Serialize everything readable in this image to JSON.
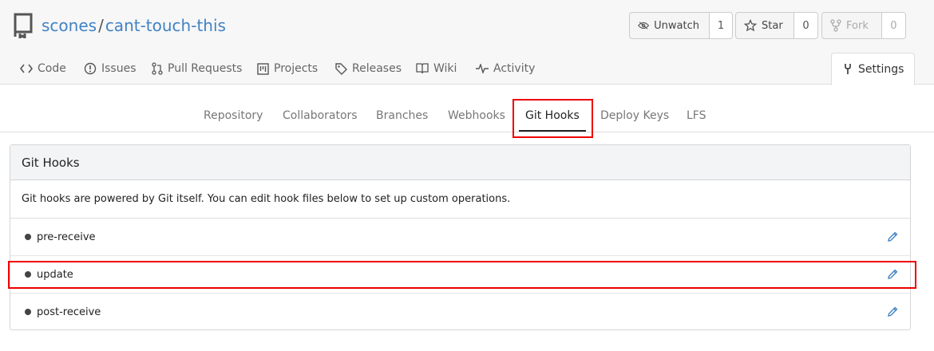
{
  "repo": {
    "owner": "scones",
    "separator": "/",
    "name": "cant-touch-this"
  },
  "actions": {
    "watch": {
      "label": "Unwatch",
      "count": "1"
    },
    "star": {
      "label": "Star",
      "count": "0"
    },
    "fork": {
      "label": "Fork",
      "count": "0"
    }
  },
  "repo_tabs": [
    "Code",
    "Issues",
    "Pull Requests",
    "Projects",
    "Releases",
    "Wiki",
    "Activity",
    "Settings"
  ],
  "settings_tabs": [
    "Repository",
    "Collaborators",
    "Branches",
    "Webhooks",
    "Git Hooks",
    "Deploy Keys",
    "LFS"
  ],
  "active_settings_tab": "Git Hooks",
  "panel": {
    "title": "Git Hooks",
    "description": "Git hooks are powered by Git itself. You can edit hook files below to set up custom operations.",
    "hooks": [
      "pre-receive",
      "update",
      "post-receive"
    ]
  },
  "colors": {
    "link": "#4183c4",
    "highlight": "#ee0000"
  }
}
